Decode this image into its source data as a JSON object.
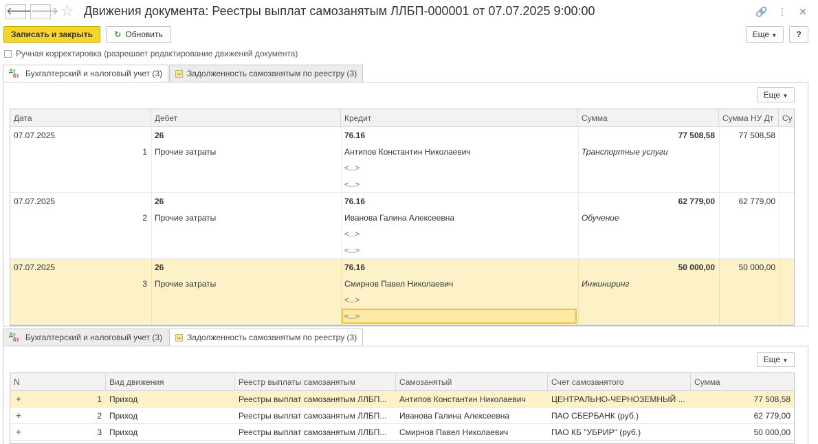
{
  "window": {
    "title": "Движения документа: Реестры выплат самозанятым ЛЛБП-000001 от 07.07.2025 9:00:00",
    "back_icon": "arrow-left-icon",
    "forward_icon": "arrow-right-icon",
    "favorite_icon": "star-icon",
    "link_icon": "link-icon",
    "menu_icon": "kebab-icon",
    "close_icon": "close-icon"
  },
  "toolbar": {
    "save_close_label": "Записать и закрыть",
    "refresh_label": "Обновить",
    "more_label": "Еще",
    "help_label": "?"
  },
  "manual_edit": {
    "label": "Ручная корректировка (разрешает редактирование движений документа)",
    "checked": false
  },
  "tabs": [
    {
      "label": "Бухгалтерский и налоговый учет (3)",
      "icon": "dt-kt-icon"
    },
    {
      "label": "Задолженность самозанятым по реестру (3)",
      "icon": "register-icon"
    }
  ],
  "accounting": {
    "more_label": "Еще",
    "columns": [
      "Дата",
      "Дебет",
      "Кредит",
      "Сумма",
      "Сумма НУ Дт",
      "Су"
    ],
    "rows": [
      {
        "date": "07.07.2025",
        "num": "1",
        "debit_account": "26",
        "debit_subconto": "Прочие затраты",
        "credit_account": "76.16",
        "credit_subconto1": "Антипов Константин Николаевич",
        "credit_subconto2": "<...>",
        "credit_subconto3": "<...>",
        "amount": "77 508,58",
        "content": "Транспортные услуги",
        "amount_nu_dt": "77 508,58"
      },
      {
        "date": "07.07.2025",
        "num": "2",
        "debit_account": "26",
        "debit_subconto": "Прочие затраты",
        "credit_account": "76.16",
        "credit_subconto1": "Иванова Галина Алексеевна",
        "credit_subconto2": "<...>",
        "credit_subconto3": "<...>",
        "amount": "62 779,00",
        "content": "Обучение",
        "amount_nu_dt": "62 779,00"
      },
      {
        "date": "07.07.2025",
        "num": "3",
        "debit_account": "26",
        "debit_subconto": "Прочие затраты",
        "credit_account": "76.16",
        "credit_subconto1": "Смирнов Павел Николаевич",
        "credit_subconto2": "<...>",
        "credit_subconto3": "<...>",
        "amount": "50 000,00",
        "content": "Инжиниринг",
        "amount_nu_dt": "50 000,00"
      }
    ]
  },
  "debt": {
    "more_label": "Еще",
    "columns": [
      "N",
      "Вид движения",
      "Реестр выплаты самозанятым",
      "Самозанятый",
      "Счет самозанятого",
      "Сумма"
    ],
    "rows": [
      {
        "n": "1",
        "kind": "Приход",
        "registry": "Реестры выплат самозанятым ЛЛБП...",
        "person": "Антипов Константин Николаевич",
        "account": "ЦЕНТРАЛЬНО-ЧЕРНОЗЕМНЫЙ ...",
        "amount": "77 508,58"
      },
      {
        "n": "2",
        "kind": "Приход",
        "registry": "Реестры выплат самозанятым ЛЛБП...",
        "person": "Иванова Галина Алексеевна",
        "account": "ПАО СБЕРБАНК (руб.)",
        "amount": "62 779,00"
      },
      {
        "n": "3",
        "kind": "Приход",
        "registry": "Реестры выплат самозанятым ЛЛБП...",
        "person": "Смирнов Павел Николаевич",
        "account": "ПАО КБ \"УБРИР\" (руб.)",
        "amount": "50 000,00"
      }
    ]
  },
  "colors": {
    "accent": "#f5d626",
    "selected_row": "#fdf1c7",
    "plus": "#3a9a3a"
  }
}
